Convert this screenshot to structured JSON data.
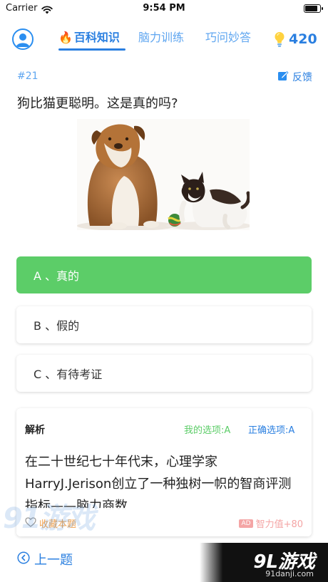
{
  "status": {
    "carrier": "Carrier",
    "time": "9:54 PM",
    "battery_level": 0.9
  },
  "nav": {
    "tabs": [
      {
        "label": "百科知识",
        "active": true
      },
      {
        "label": "脑力训练",
        "active": false
      },
      {
        "label": "巧问妙答",
        "active": false
      }
    ],
    "points": "420"
  },
  "question": {
    "number": "#21",
    "feedback_label": "反馈",
    "text": "狗比猫更聪明。这是真的吗?",
    "image": "bulldog-and-kitten-photo"
  },
  "options": [
    {
      "label": "A 、真的",
      "state": "correct"
    },
    {
      "label": "B 、假的",
      "state": "normal"
    },
    {
      "label": "C 、有待考证",
      "state": "normal"
    }
  ],
  "analysis": {
    "title": "解析",
    "my_choice": "我的选项:A",
    "correct_choice": "正确选项:A",
    "text": "在二十世纪七十年代末，心理学家HarryJ.Jerison创立了一种独树一帜的智商评测指标——脑力商数",
    "favorite_label": "收藏本题",
    "reward_badge": "AD",
    "reward_label": "智力值+80"
  },
  "footer": {
    "prev_label": "上一题"
  },
  "watermark": {
    "left_text": "91游戏",
    "logo": "9L游戏",
    "url": "91danji.com"
  },
  "colors": {
    "accent": "#2a7fe0",
    "correct": "#5ccd68",
    "favorite": "#f0a04b"
  }
}
